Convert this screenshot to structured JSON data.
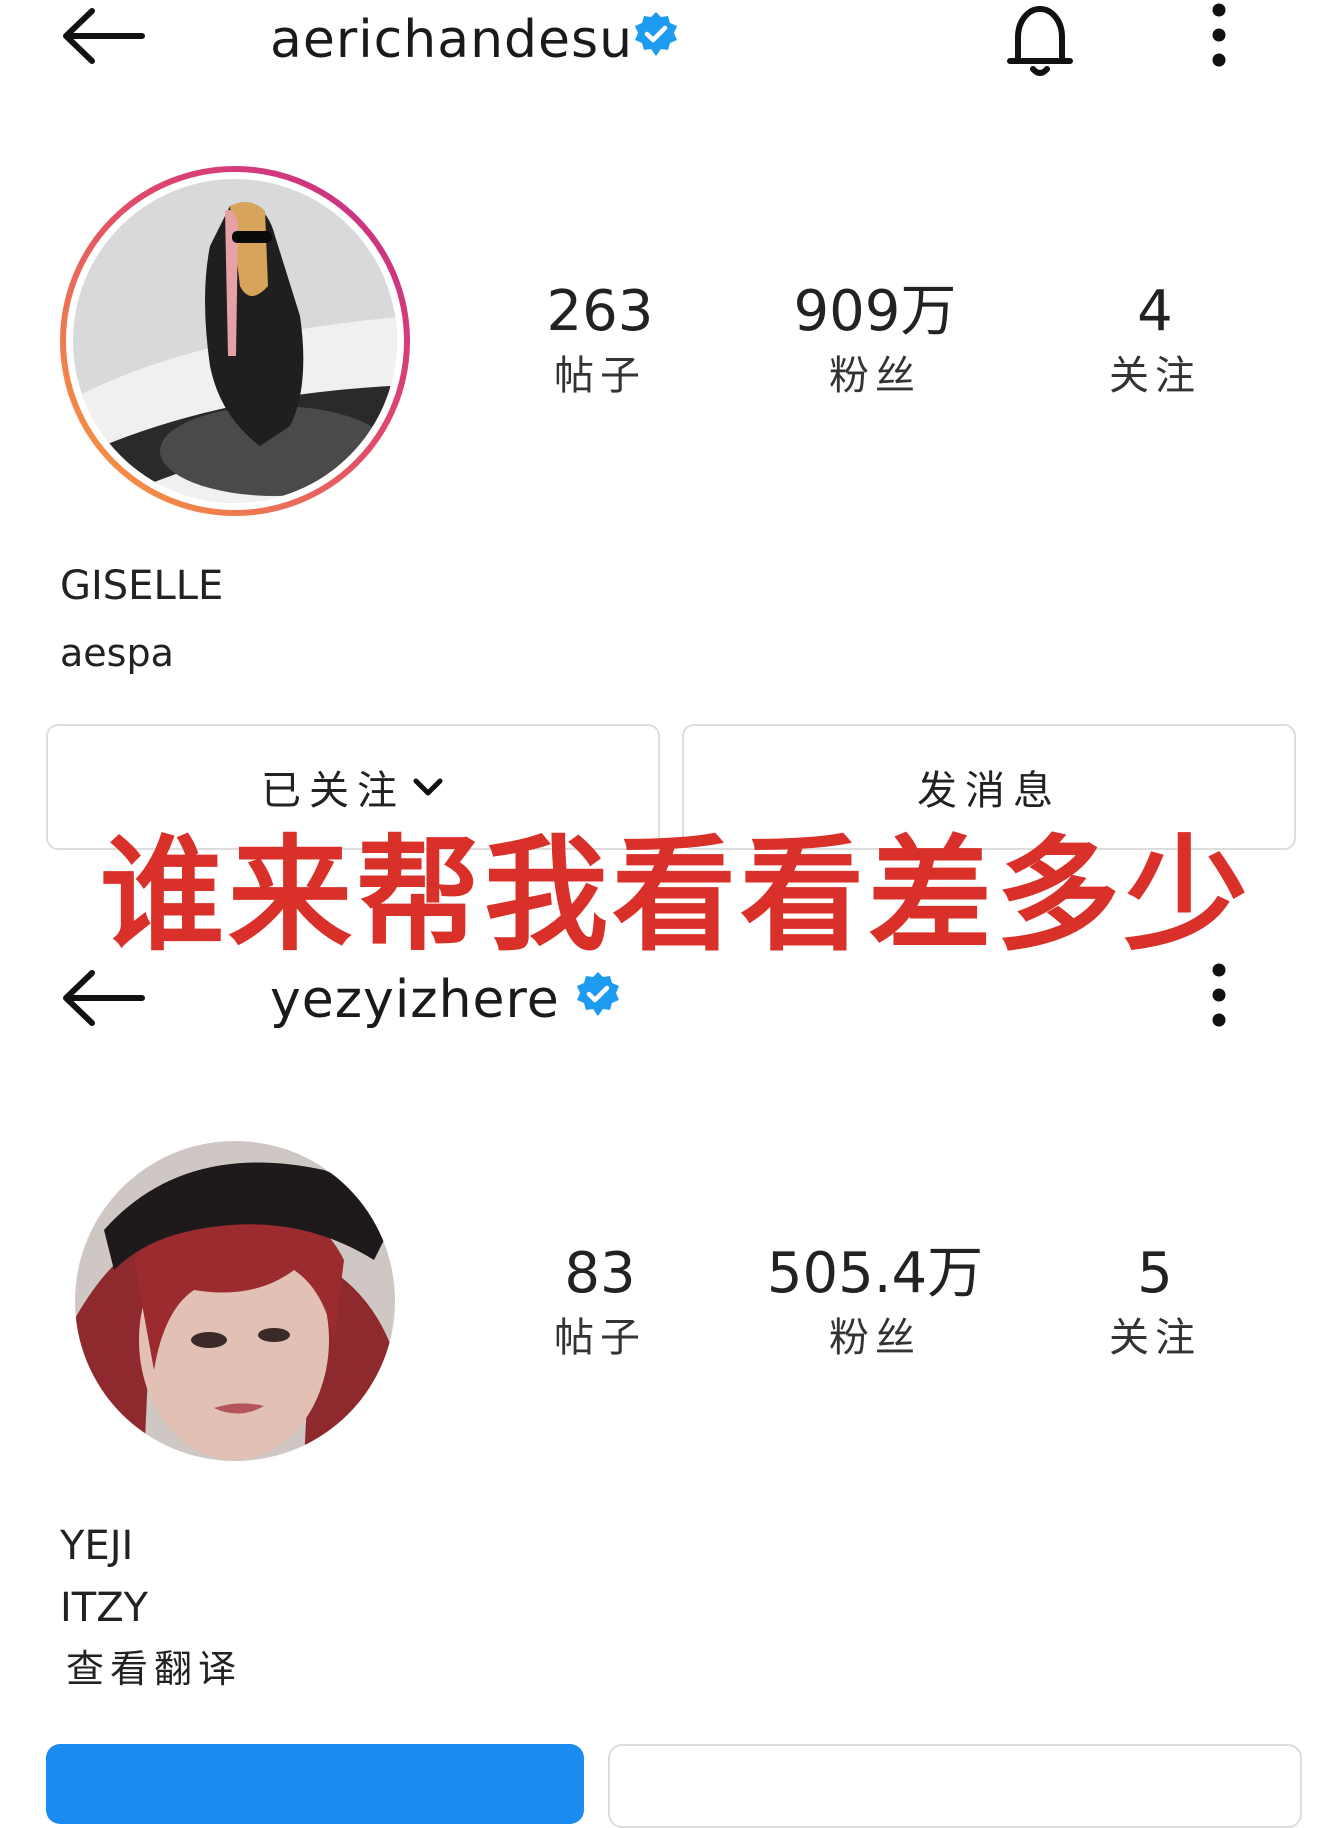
{
  "profile1": {
    "username": "aerichandesu",
    "verified": true,
    "stats": [
      {
        "value": "263",
        "label": "帖子"
      },
      {
        "value": "909万",
        "label": "粉丝"
      },
      {
        "value": "4",
        "label": "关注"
      }
    ],
    "name": "GISELLE",
    "bio": "aespa",
    "buttons": {
      "following": "已关注",
      "message": "发消息"
    }
  },
  "overlay": {
    "text": "谁来帮我看看差多少",
    "color": "#d9302a"
  },
  "profile2": {
    "username": "yezyizhere",
    "verified": true,
    "stats": [
      {
        "value": "83",
        "label": "帖子"
      },
      {
        "value": "505.4万",
        "label": "粉丝"
      },
      {
        "value": "5",
        "label": "关注"
      }
    ],
    "name": "YEJI",
    "bio": "ITZY",
    "translate": "查看翻译"
  },
  "colors": {
    "verified": "#1d9bf0",
    "primary_button": "#1a8cf0",
    "story_ring_start": "#f9a33a",
    "story_ring_end": "#c42a8c"
  },
  "icons": [
    "back-arrow-icon",
    "verified-badge-icon",
    "bell-icon",
    "more-vertical-icon"
  ]
}
